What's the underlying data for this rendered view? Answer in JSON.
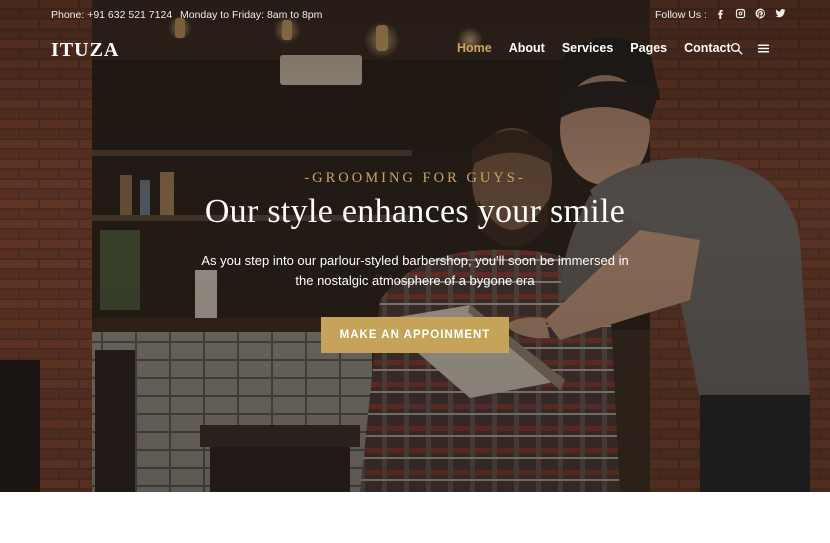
{
  "topbar": {
    "phone": "Phone: +91 632 521 7124",
    "hours": "Monday to Friday: 8am to 8pm",
    "follow_label": "Follow Us :",
    "social": [
      "facebook-icon",
      "instagram-icon",
      "pinterest-icon",
      "twitter-icon"
    ]
  },
  "brand": {
    "logo": "ITUZA"
  },
  "nav": {
    "items": [
      {
        "label": "Home",
        "active": true
      },
      {
        "label": "About"
      },
      {
        "label": "Services"
      },
      {
        "label": "Pages"
      },
      {
        "label": "Contact"
      }
    ],
    "icons": [
      "search-icon",
      "hamburger-menu-icon"
    ]
  },
  "hero": {
    "subtitle": "-GROOMING FOR GUYS-",
    "headline": "Our style enhances your smile",
    "description": "As you step into our parlour-styled barbershop, you'll soon be immersed in the nostalgic atmosphere of a bygone era",
    "cta_label": "MAKE AN APPOINMENT"
  },
  "colors": {
    "accent": "#c5a45a",
    "active_nav": "#c9a660",
    "text": "#ffffff"
  }
}
